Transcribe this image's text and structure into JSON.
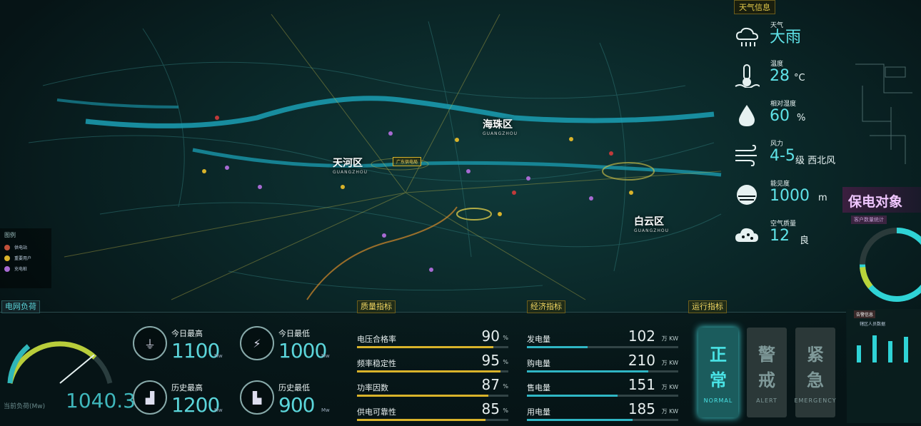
{
  "map": {
    "districts": [
      {
        "name": "天河区",
        "sub": "GUANGZHOU"
      },
      {
        "name": "海珠区",
        "sub": "GUANGZHOU"
      },
      {
        "name": "白云区",
        "sub": "GUANGZHOU"
      }
    ],
    "center_tag": "广东供电局"
  },
  "legend": {
    "title": "图例",
    "items": [
      {
        "label": "供电站",
        "color": "#c0503a"
      },
      {
        "label": "重要用户",
        "color": "#d9b32a"
      },
      {
        "label": "充电桩",
        "color": "#a76ad2"
      }
    ]
  },
  "weather": {
    "title": "天气信息",
    "rows": [
      {
        "icon": "rain-cloud-icon",
        "label": "天气",
        "value": "大雨",
        "unit": ""
      },
      {
        "icon": "thermometer-icon",
        "label": "温度",
        "value": "28",
        "unit": "°C"
      },
      {
        "icon": "humidity-drop-icon",
        "label": "相对湿度",
        "value": "60",
        "unit": "%"
      },
      {
        "icon": "wind-icon",
        "label": "风力",
        "value": "4-5",
        "unit": "级 西北风"
      },
      {
        "icon": "visibility-sun-icon",
        "label": "能见度",
        "value": "1000",
        "unit": "m"
      },
      {
        "icon": "air-quality-cloud-icon",
        "label": "空气质量",
        "value": "12",
        "unit": "良"
      }
    ]
  },
  "protection": {
    "title": "保电对象",
    "subtitle": "客户数量统计",
    "donut_fraction": 0.75
  },
  "grid_load": {
    "title": "电网负荷",
    "current_label": "当前负荷(Mw)",
    "current_value": "1040.3",
    "gauge_fraction": 0.78,
    "stats": [
      {
        "icon": "plug-icon",
        "label": "今日最高",
        "value": "1100",
        "unit": "Mw"
      },
      {
        "icon": "lightning-plug-icon",
        "label": "今日最低",
        "value": "1000",
        "unit": "Mw"
      },
      {
        "icon": "chart-up-icon",
        "label": "历史最高",
        "value": "1200",
        "unit": "Mw"
      },
      {
        "icon": "chart-down-icon",
        "label": "历史最低",
        "value": "900",
        "unit": "Mw"
      }
    ]
  },
  "quality": {
    "title": "质量指标",
    "color": "#d9b32a",
    "items": [
      {
        "label": "电压合格率",
        "value": "90",
        "unit": "%",
        "fraction": 0.9
      },
      {
        "label": "频率稳定性",
        "value": "95",
        "unit": "%",
        "fraction": 0.95
      },
      {
        "label": "功率因数",
        "value": "87",
        "unit": "%",
        "fraction": 0.87
      },
      {
        "label": "供电可靠性",
        "value": "85",
        "unit": "%",
        "fraction": 0.85
      }
    ]
  },
  "economy": {
    "title": "经济指标",
    "color": "#2fb6c4",
    "items": [
      {
        "label": "发电量",
        "value": "102",
        "unit": "万 KW",
        "fraction": 0.4
      },
      {
        "label": "购电量",
        "value": "210",
        "unit": "万 KW",
        "fraction": 0.8
      },
      {
        "label": "售电量",
        "value": "151",
        "unit": "万 KW",
        "fraction": 0.6
      },
      {
        "label": "用电量",
        "value": "185",
        "unit": "万 KW",
        "fraction": 0.7
      }
    ]
  },
  "operation": {
    "title": "运行指标",
    "buttons": [
      {
        "big1": "正",
        "big2": "常",
        "en": "NORMAL",
        "bg": "#1b5c5d",
        "fg": "#49e3e6",
        "active": true
      },
      {
        "big1": "警",
        "big2": "戒",
        "en": "ALERT",
        "bg": "#2b3838",
        "fg": "#7f9999",
        "active": false
      },
      {
        "big1": "紧",
        "big2": "急",
        "en": "EMERGENCY",
        "bg": "#2b3838",
        "fg": "#7f9999",
        "active": false
      }
    ]
  },
  "side_alert": {
    "tag": "告警信息",
    "text": "辖区人员数据"
  }
}
